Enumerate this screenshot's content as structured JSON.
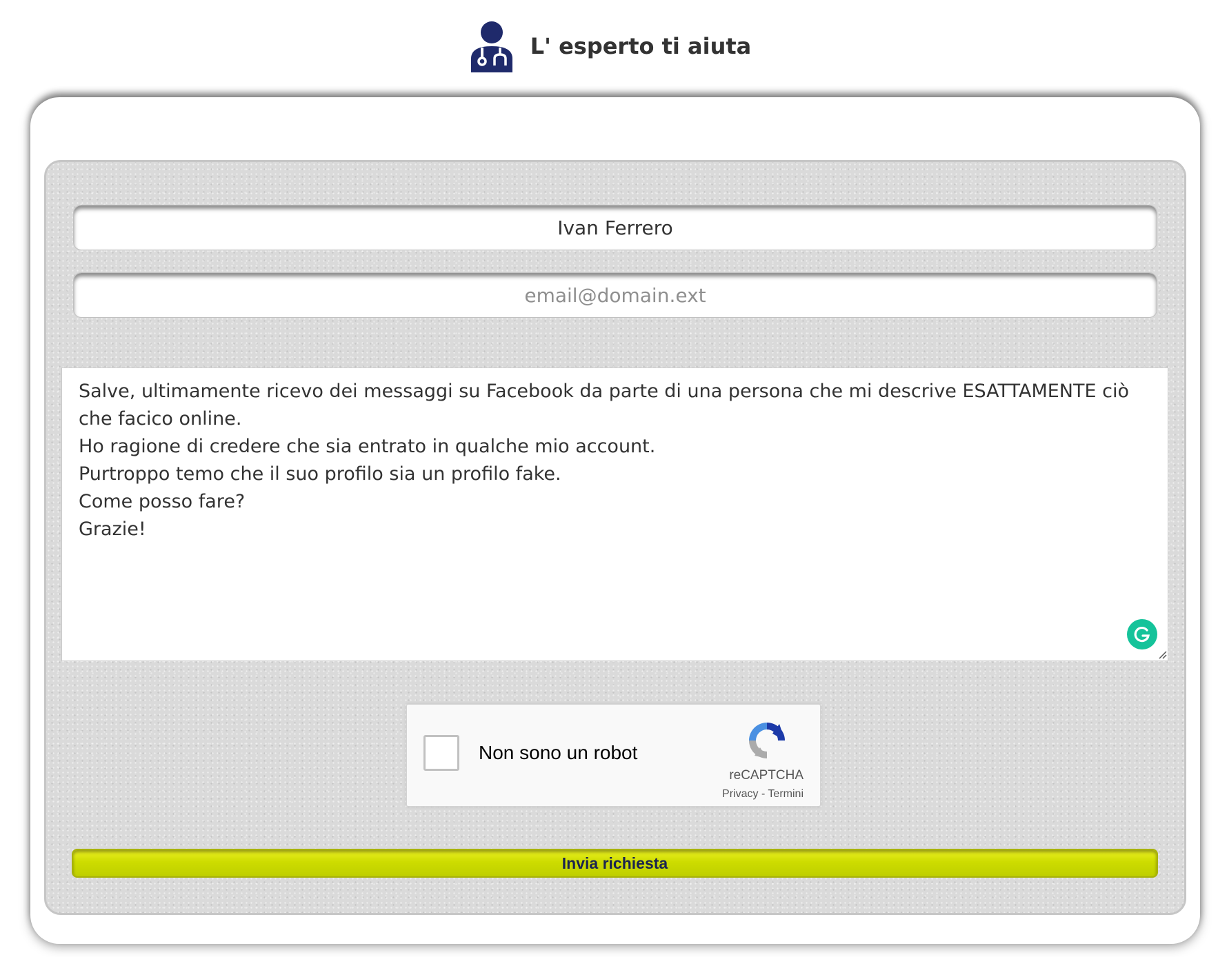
{
  "header": {
    "title": "L' esperto ti aiuta",
    "logo_icon": "doctor-stethoscope-icon",
    "logo_color": "#1f2a6b"
  },
  "form": {
    "name_value": "Ivan Ferrero",
    "email_placeholder": "email@domain.ext",
    "message_lines": [
      "Salve, ultimamente ricevo dei messaggi su Facebook da parte di una persona che mi descrive ESATTAMENTE ciò che facico online.",
      "Ho ragione di credere che sia entrato in qualche mio account.",
      "Purtroppo temo che il suo profilo sia un profilo fake.",
      "Come posso fare?",
      "Grazie!"
    ],
    "grammarly_icon": "grammarly-icon",
    "submit_label": "Invia richiesta",
    "submit_color": "#cddc00"
  },
  "recaptcha": {
    "checkbox_label": "Non sono un robot",
    "brand": "reCAPTCHA",
    "links": "Privacy - Termini",
    "checked": false
  }
}
